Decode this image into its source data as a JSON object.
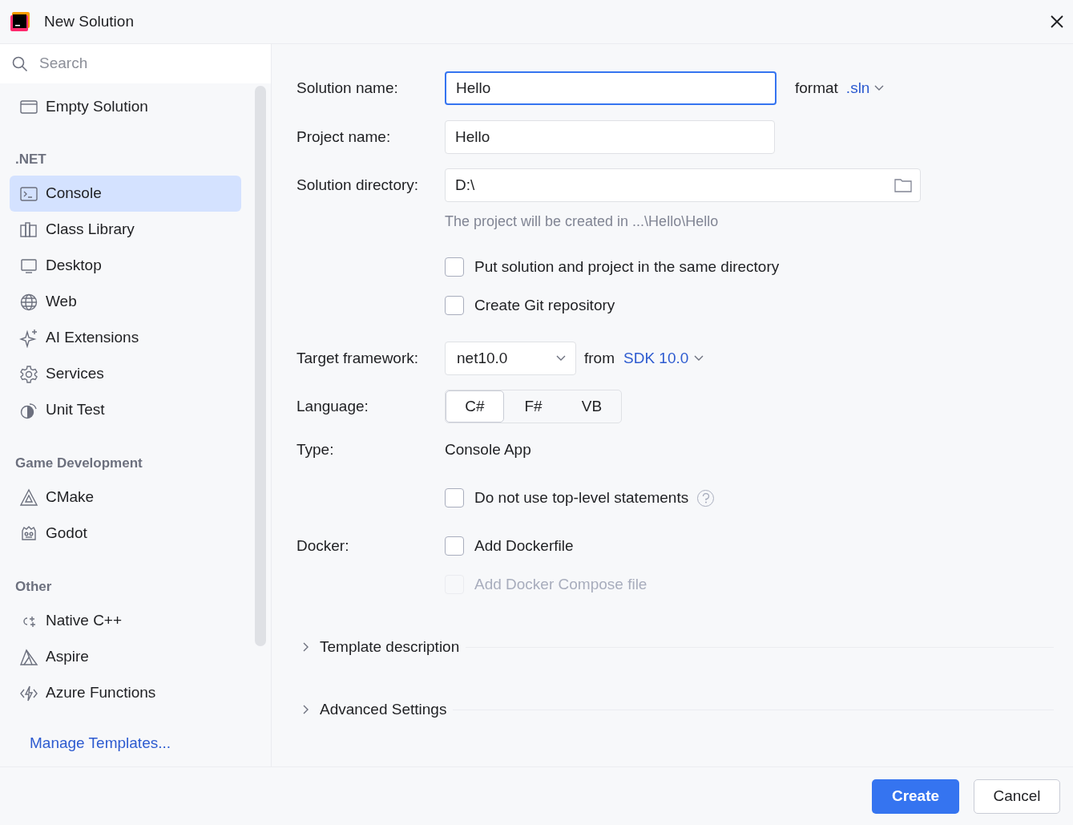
{
  "window": {
    "title": "New Solution"
  },
  "sidebar": {
    "search": {
      "placeholder": "Search"
    },
    "groups": [
      {
        "items": [
          {
            "label": "Empty Solution",
            "selected": false
          }
        ]
      },
      {
        "title": ".NET",
        "items": [
          {
            "label": "Console",
            "selected": true
          },
          {
            "label": "Class Library",
            "selected": false
          },
          {
            "label": "Desktop",
            "selected": false
          },
          {
            "label": "Web",
            "selected": false
          },
          {
            "label": "AI Extensions",
            "selected": false
          },
          {
            "label": "Services",
            "selected": false
          },
          {
            "label": "Unit Test",
            "selected": false
          }
        ]
      },
      {
        "title": "Game Development",
        "items": [
          {
            "label": "CMake",
            "selected": false
          },
          {
            "label": "Godot",
            "selected": false
          }
        ]
      },
      {
        "title": "Other",
        "items": [
          {
            "label": "Native C++",
            "selected": false
          },
          {
            "label": "Aspire",
            "selected": false
          },
          {
            "label": "Azure Functions",
            "selected": false
          }
        ]
      }
    ],
    "manage_link": "Manage Templates..."
  },
  "form": {
    "solution_name": {
      "label": "Solution name:",
      "value": "Hello",
      "focused": true
    },
    "format": {
      "label": "format",
      "value": ".sln"
    },
    "project_name": {
      "label": "Project name:",
      "value": "Hello",
      "focused": false
    },
    "solution_directory": {
      "label": "Solution directory:",
      "value": "D:\\"
    },
    "hint": "The project will be created in ...\\Hello\\Hello",
    "options": [
      {
        "label": "Put solution and project in the same directory",
        "checked": false,
        "disabled": false
      },
      {
        "label": "Create Git repository",
        "checked": false,
        "disabled": false
      }
    ],
    "target_framework": {
      "label": "Target framework:",
      "value": "net10.0",
      "from": "from",
      "sdk": "SDK 10.0"
    },
    "language": {
      "label": "Language:",
      "choices": [
        {
          "label": "C#",
          "selected": true
        },
        {
          "label": "F#",
          "selected": false
        },
        {
          "label": "VB",
          "selected": false
        }
      ]
    },
    "type": {
      "label": "Type:",
      "value": "Console App"
    },
    "top_level": {
      "label": "Do not use top-level statements",
      "checked": false,
      "disabled": false
    },
    "docker": {
      "label": "Docker:",
      "options": [
        {
          "label": "Add Dockerfile",
          "checked": false,
          "disabled": false
        },
        {
          "label": "Add Docker Compose file",
          "checked": false,
          "disabled": true
        }
      ]
    },
    "sections": [
      {
        "label": "Template description",
        "expanded": false
      },
      {
        "label": "Advanced Settings",
        "expanded": false
      }
    ]
  },
  "buttons": [
    {
      "label": "Create",
      "kind": "primary"
    },
    {
      "label": "Cancel",
      "kind": "secondary"
    }
  ]
}
